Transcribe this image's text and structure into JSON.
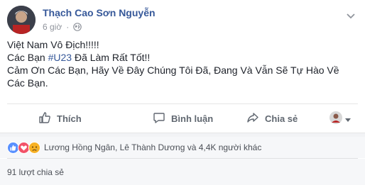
{
  "post": {
    "author": "Thạch Cao Sơn Nguyễn",
    "time": "6 giờ",
    "dot": "·",
    "lines": {
      "line1": "Việt Nam Vô Địch!!!!!",
      "line2_prefix": "Các Bạn ",
      "hashtag": "#U23",
      "line2_suffix": " Đã Làm Rất Tốt!!",
      "line3": "Cảm Ơn Các Bạn, Hãy Về Đây Chúng Tôi Đã, Đang Và Vẫn Sẽ Tự Hào Về Các Bạn."
    }
  },
  "actions": {
    "like": "Thích",
    "comment": "Bình luận",
    "share": "Chia sẻ"
  },
  "reactions": {
    "summary": "Lương Hồng Ngân, Lê Thành Dương và 4,4K người khác",
    "types": [
      "like-icon",
      "love-icon",
      "sad-icon"
    ]
  },
  "shares": {
    "count_text": "91 lượt chia sẻ"
  },
  "colors": {
    "name_blue": "#365899",
    "like_blue": "#5890ff",
    "love_red": "#f25268",
    "sad_yellow": "#f7b125"
  }
}
